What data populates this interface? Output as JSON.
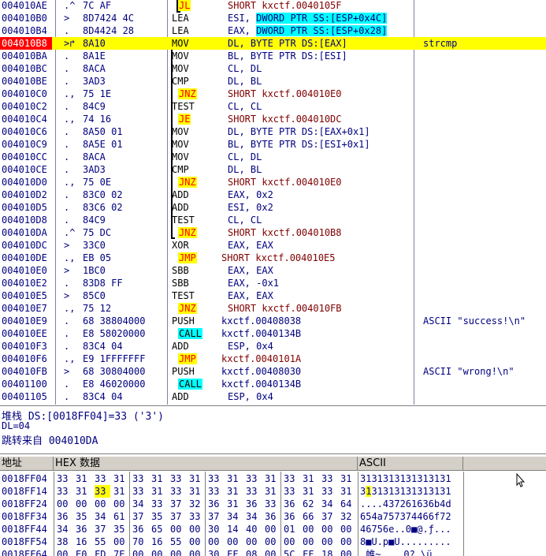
{
  "disasm": [
    {
      "addr": "004010AE",
      "mark": ".^",
      "hex": "7C AF",
      "mnem": "JL",
      "op": "SHORT kxctf.0040105F",
      "type": "jmp"
    },
    {
      "addr": "004010B0",
      "mark": ">",
      "hex": "8D7424 4C",
      "mnem": "LEA",
      "op": "ESI, ",
      "arg": "DWORD PTR SS:[ESP+0x4C]"
    },
    {
      "addr": "004010B4",
      "mark": ".",
      "hex": "8D4424 28",
      "mnem": "LEA",
      "op": "EAX, ",
      "arg": "DWORD PTR SS:[ESP+0x28]"
    },
    {
      "addr": "004010B8",
      "mark": ">↱",
      "hex": "8A10",
      "mnem": "MOV",
      "op": "DL, BYTE PTR DS:[EAX]",
      "cmt": "strcmp",
      "cur": true
    },
    {
      "addr": "004010BA",
      "mark": ".",
      "hex": "8A1E",
      "mnem": "MOV",
      "op": "BL, BYTE PTR DS:[ESI]"
    },
    {
      "addr": "004010BC",
      "mark": ".",
      "hex": "8ACA",
      "mnem": "MOV",
      "op": "CL, DL"
    },
    {
      "addr": "004010BE",
      "mark": ".",
      "hex": "3AD3",
      "mnem": "CMP",
      "op": "DL, BL"
    },
    {
      "addr": "004010C0",
      "mark": ".,",
      "hex": "75 1E",
      "mnem": "JNZ",
      "op": "SHORT kxctf.004010E0",
      "type": "jmp"
    },
    {
      "addr": "004010C2",
      "mark": ".",
      "hex": "84C9",
      "mnem": "TEST",
      "op": "CL, CL"
    },
    {
      "addr": "004010C4",
      "mark": ".,",
      "hex": "74 16",
      "mnem": "JE",
      "op": "SHORT kxctf.004010DC",
      "type": "jmp"
    },
    {
      "addr": "004010C6",
      "mark": ".",
      "hex": "8A50 01",
      "mnem": "MOV",
      "op": "DL, BYTE PTR DS:[EAX+0x1]"
    },
    {
      "addr": "004010C9",
      "mark": ".",
      "hex": "8A5E 01",
      "mnem": "MOV",
      "op": "BL, BYTE PTR DS:[ESI+0x1]"
    },
    {
      "addr": "004010CC",
      "mark": ".",
      "hex": "8ACA",
      "mnem": "MOV",
      "op": "CL, DL"
    },
    {
      "addr": "004010CE",
      "mark": ".",
      "hex": "3AD3",
      "mnem": "CMP",
      "op": "DL, BL"
    },
    {
      "addr": "004010D0",
      "mark": ".,",
      "hex": "75 0E",
      "mnem": "JNZ",
      "op": "SHORT kxctf.004010E0",
      "type": "jmp"
    },
    {
      "addr": "004010D2",
      "mark": ".",
      "hex": "83C0 02",
      "mnem": "ADD",
      "op": "EAX, 0x2"
    },
    {
      "addr": "004010D5",
      "mark": ".",
      "hex": "83C6 02",
      "mnem": "ADD",
      "op": "ESI, 0x2"
    },
    {
      "addr": "004010D8",
      "mark": ".",
      "hex": "84C9",
      "mnem": "TEST",
      "op": "CL, CL"
    },
    {
      "addr": "004010DA",
      "mark": ".^",
      "hex": "75 DC",
      "mnem": "JNZ",
      "op": "SHORT kxctf.004010B8",
      "type": "jmp"
    },
    {
      "addr": "004010DC",
      "mark": ">",
      "hex": "33C0",
      "mnem": "XOR",
      "op": "EAX, EAX"
    },
    {
      "addr": "004010DE",
      "mark": ".,",
      "hex": "EB 05",
      "mnem": "JMP",
      "op": "SHORT kxctf.004010E5",
      "type": "jmp"
    },
    {
      "addr": "004010E0",
      "mark": ">",
      "hex": "1BC0",
      "mnem": "SBB",
      "op": "EAX, EAX"
    },
    {
      "addr": "004010E2",
      "mark": ".",
      "hex": "83D8 FF",
      "mnem": "SBB",
      "op": "EAX, -0x1"
    },
    {
      "addr": "004010E5",
      "mark": ">",
      "hex": "85C0",
      "mnem": "TEST",
      "op": "EAX, EAX"
    },
    {
      "addr": "004010E7",
      "mark": ".,",
      "hex": "75 12",
      "mnem": "JNZ",
      "op": "SHORT kxctf.004010FB",
      "type": "jmp"
    },
    {
      "addr": "004010E9",
      "mark": ".",
      "hex": "68 38804000",
      "mnem": "PUSH",
      "op": "kxctf.00408038",
      "cmt": "ASCII \"success!\\n\"",
      "type": "push"
    },
    {
      "addr": "004010EE",
      "mark": ".",
      "hex": "E8 58020000",
      "mnem": "CALL",
      "op": "kxctf.0040134B",
      "type": "call"
    },
    {
      "addr": "004010F3",
      "mark": ".",
      "hex": "83C4 04",
      "mnem": "ADD",
      "op": "ESP, 0x4"
    },
    {
      "addr": "004010F6",
      "mark": ".,",
      "hex": "E9 1FFFFFFF",
      "mnem": "JMP",
      "op": "kxctf.0040101A",
      "type": "jmp"
    },
    {
      "addr": "004010FB",
      "mark": ">",
      "hex": "68 30804000",
      "mnem": "PUSH",
      "op": "kxctf.00408030",
      "cmt": "ASCII \"wrong!\\n\"",
      "type": "push"
    },
    {
      "addr": "00401100",
      "mark": ".",
      "hex": "E8 46020000",
      "mnem": "CALL",
      "op": "kxctf.0040134B",
      "type": "call"
    },
    {
      "addr": "00401105",
      "mark": ".",
      "hex": "83C4 04",
      "mnem": "ADD",
      "op": "ESP, 0x4"
    }
  ],
  "info": {
    "line1": "堆栈 DS:[0018FF04]=33 ('3')",
    "line2": "DL=04",
    "line3": "跳转来自 004010DA"
  },
  "dump": {
    "headers": {
      "addr": "地址",
      "hex": "HEX 数据",
      "ascii": "ASCII"
    },
    "rows": [
      {
        "addr": "0018FF04",
        "bytes": [
          "33",
          "31",
          "33",
          "31",
          "33",
          "31",
          "33",
          "31",
          "33",
          "31",
          "33",
          "31",
          "33",
          "31",
          "33",
          "31"
        ],
        "ascii": "3131313131313131"
      },
      {
        "addr": "0018FF14",
        "bytes": [
          "33",
          "31",
          "33",
          "31",
          "33",
          "31",
          "33",
          "31",
          "33",
          "31",
          "33",
          "31",
          "33",
          "31",
          "33",
          "31"
        ],
        "ascii": "3131313131313131"
      },
      {
        "addr": "0018FF24",
        "bytes": [
          "00",
          "00",
          "00",
          "00",
          "34",
          "33",
          "37",
          "32",
          "36",
          "31",
          "36",
          "33",
          "36",
          "62",
          "34",
          "64"
        ],
        "ascii": "....437261636b4d"
      },
      {
        "addr": "0018FF34",
        "bytes": [
          "36",
          "35",
          "34",
          "61",
          "37",
          "35",
          "37",
          "33",
          "37",
          "34",
          "34",
          "36",
          "36",
          "66",
          "37",
          "32"
        ],
        "ascii": "654a757374466f72"
      },
      {
        "addr": "0018FF44",
        "bytes": [
          "34",
          "36",
          "37",
          "35",
          "36",
          "65",
          "00",
          "00",
          "30",
          "14",
          "40",
          "00",
          "01",
          "00",
          "00",
          "00"
        ],
        "ascii": "46756e..0■@.ƒ..."
      },
      {
        "addr": "0018FF54",
        "bytes": [
          "38",
          "16",
          "55",
          "00",
          "70",
          "16",
          "55",
          "00",
          "00",
          "00",
          "00",
          "00",
          "00",
          "00",
          "00",
          "00"
        ],
        "ascii": "8■U.p■U........."
      },
      {
        "addr": "0018FF64",
        "bytes": [
          "00",
          "E0",
          "FD",
          "7E",
          "00",
          "00",
          "00",
          "00",
          "30",
          "FF",
          "08",
          "00",
          "5C",
          "FF",
          "18",
          "00"
        ],
        "ascii": ".帷~....0?.\\ü."
      }
    ]
  }
}
